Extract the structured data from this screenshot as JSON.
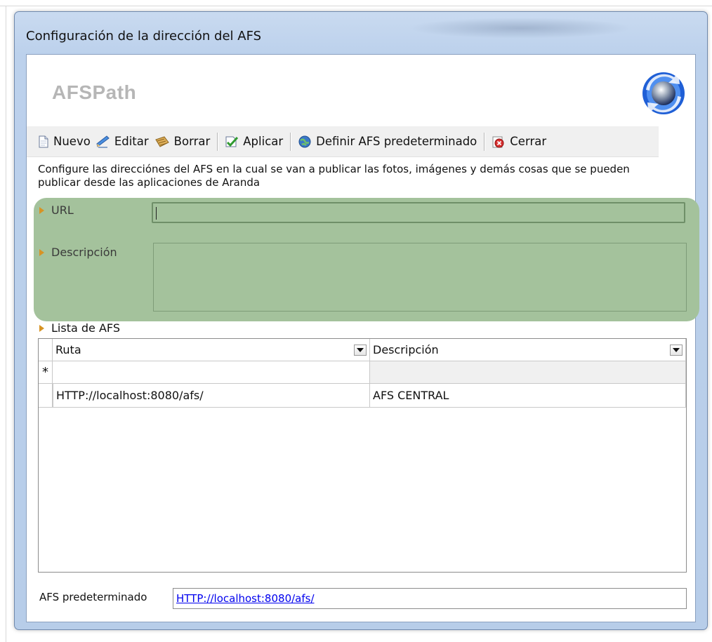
{
  "window": {
    "title": "Configuración de la dirección del AFS"
  },
  "header": {
    "title": "AFSPath",
    "logo_icon": "refresh-globe-icon"
  },
  "toolbar": {
    "items": [
      {
        "label": "Nuevo",
        "icon": "new-document-icon"
      },
      {
        "label": "Editar",
        "icon": "edit-icon"
      },
      {
        "label": "Borrar",
        "icon": "delete-icon"
      },
      {
        "label": "Aplicar",
        "icon": "apply-check-icon"
      },
      {
        "label": "Definir AFS predeterminado",
        "icon": "globe-default-icon"
      },
      {
        "label": "Cerrar",
        "icon": "close-red-icon"
      }
    ]
  },
  "description": "Configure las direcciónes del AFS en la cual se van a publicar las fotos, imágenes y demás cosas que se pueden publicar desde las aplicaciones de Aranda",
  "form": {
    "url_label": "URL",
    "url_value": "",
    "description_label": "Descripción",
    "description_value": ""
  },
  "list": {
    "label": "Lista de AFS",
    "columns": [
      "Ruta",
      "Descripción"
    ],
    "new_row_marker": "*",
    "rows": [
      {
        "ruta": "HTTP://localhost:8080/afs/",
        "descripcion": "AFS CENTRAL"
      }
    ]
  },
  "default_afs": {
    "label": "AFS predeterminado",
    "value": "HTTP://localhost:8080/afs/"
  },
  "colors": {
    "highlight_panel": "#a4c29c",
    "window_frame": "#bcd1ec",
    "link": "#0000ee",
    "arrow": "#d79324"
  }
}
